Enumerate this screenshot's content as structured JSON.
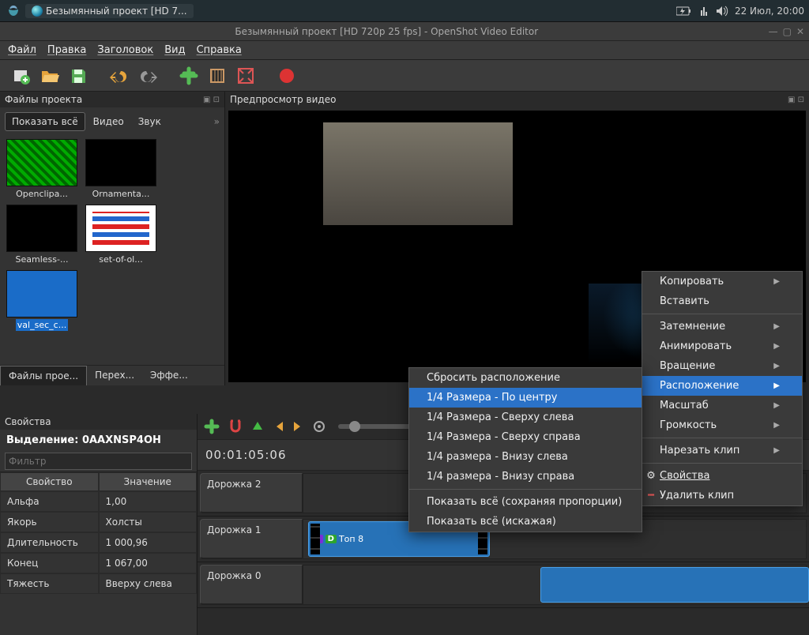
{
  "taskbar": {
    "app_label": "Безымянный проект [HD 7...",
    "clock": "22 Июл, 20:00"
  },
  "window": {
    "title": "Безымянный проект [HD 720p 25 fps] - OpenShot Video Editor"
  },
  "menubar": [
    "Файл",
    "Правка",
    "Заголовок",
    "Вид",
    "Справка"
  ],
  "project_files": {
    "title": "Файлы проекта",
    "filter_tabs": {
      "all": "Показать всё",
      "video": "Видео",
      "audio": "Звук"
    },
    "items": [
      {
        "label": "Openclipa...",
        "kind": "green"
      },
      {
        "label": "Ornamenta...",
        "kind": "black"
      },
      {
        "label": "Seamless-...",
        "kind": "black"
      },
      {
        "label": "set-of-ol...",
        "kind": "stripes"
      },
      {
        "label": "val_sec_c...",
        "kind": "sel",
        "selected": true
      }
    ],
    "bottom_tabs": [
      "Файлы прое...",
      "Перех...",
      "Эффе..."
    ]
  },
  "preview": {
    "title": "Предпросмотр видео"
  },
  "properties": {
    "title": "Свойства",
    "selection_prefix": "Выделение: ",
    "selection_id": "0AAXNSP4OH",
    "filter_placeholder": "Фильтр",
    "headers": [
      "Свойство",
      "Значение"
    ],
    "rows": [
      [
        "Альфа",
        "1,00"
      ],
      [
        "Якорь",
        "Холсты"
      ],
      [
        "Длительность",
        "1 000,96"
      ],
      [
        "Конец",
        "1 067,00"
      ],
      [
        "Тяжесть",
        "Вверху слева"
      ]
    ]
  },
  "timeline": {
    "timecode": "00:01:05:06",
    "tracks": [
      "Дорожка 2",
      "Дорожка 1",
      "Дорожка 0"
    ],
    "clip_label": "Топ 8"
  },
  "context_primary": {
    "items": [
      {
        "label": "Копировать",
        "arrow": true
      },
      {
        "label": "Вставить"
      },
      {
        "label": "Затемнение",
        "arrow": true
      },
      {
        "label": "Анимировать",
        "arrow": true
      },
      {
        "label": "Вращение",
        "arrow": true
      },
      {
        "label": "Расположение",
        "arrow": true,
        "active": true
      },
      {
        "label": "Масштаб",
        "arrow": true
      },
      {
        "label": "Громкость",
        "arrow": true
      },
      {
        "label": "Нарезать клип",
        "arrow": true
      }
    ],
    "footer": [
      {
        "label": "Свойства",
        "icon": "gear"
      },
      {
        "label": "Удалить клип",
        "icon": "delete"
      }
    ]
  },
  "context_sub": {
    "items": [
      "Сбросить расположение",
      "1/4 Размера - По центру",
      "1/4 Размера - Сверху слева",
      "1/4 Размера - Сверху справа",
      "1/4 размера - Внизу слева",
      "1/4 размера - Внизу справа",
      "Показать всё (сохраняя пропорции)",
      "Показать всё (искажая)"
    ],
    "active_index": 1
  }
}
